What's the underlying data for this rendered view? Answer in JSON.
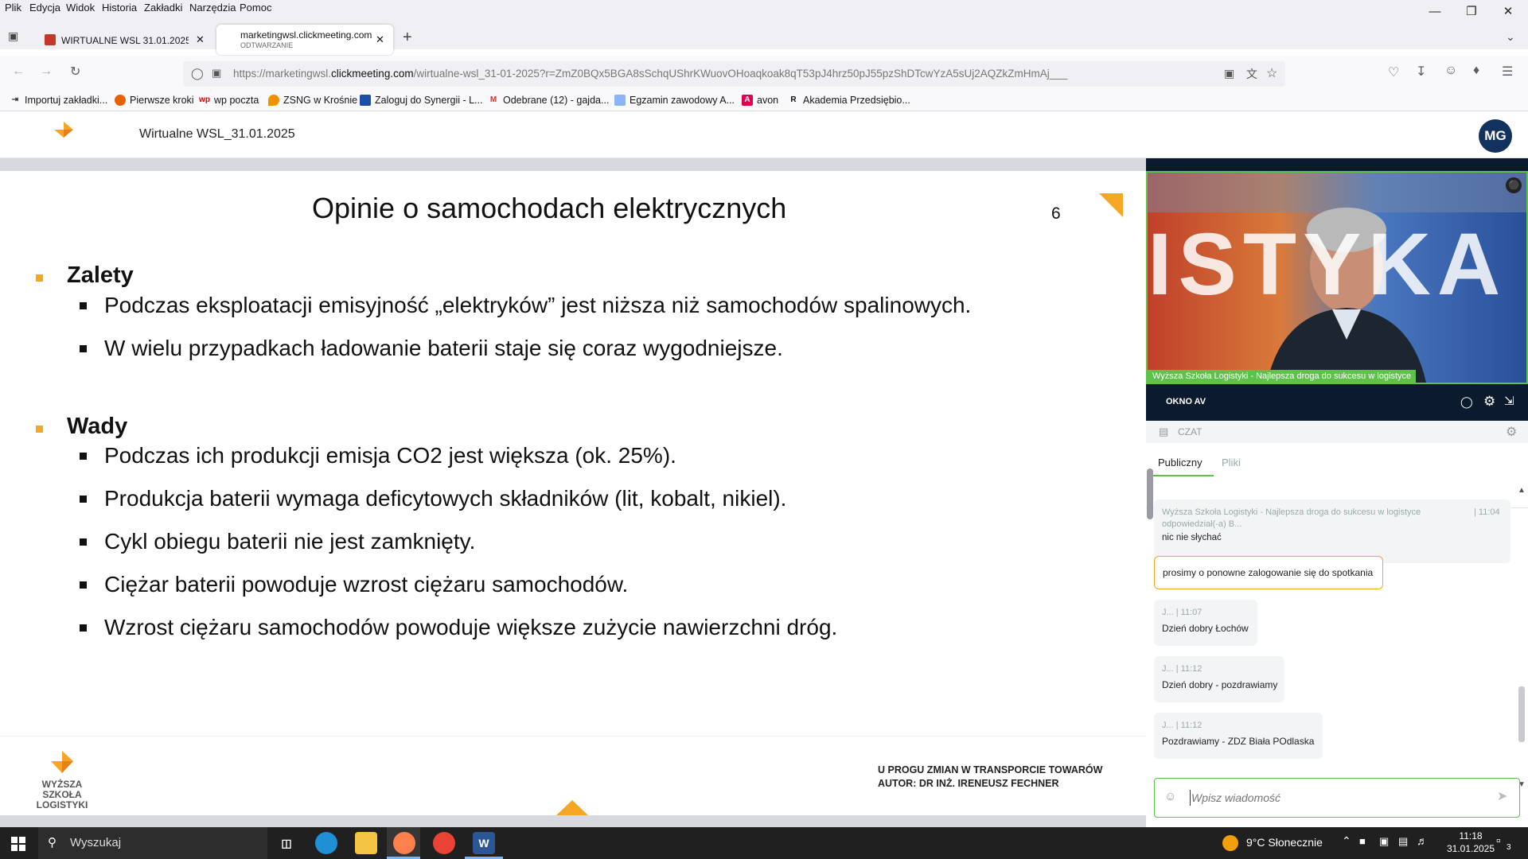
{
  "menubar": {
    "items": [
      "Plik",
      "Edycja",
      "Widok",
      "Historia",
      "Zakładki",
      "Narzędzia",
      "Pomoc"
    ]
  },
  "tabs": [
    {
      "title": "WIRTUALNE WSL 31.01.2025 - W",
      "subtitle": ""
    },
    {
      "title": "marketingwsl.clickmeeting.com",
      "subtitle": "ODTWARZANIE"
    }
  ],
  "urlbar": {
    "url_prefix": "https://marketingwsl.",
    "url_domain": "clickmeeting.com",
    "url_rest": "/wirtualne-wsl_31-01-2025?r=ZmZ0BQx5BGA8sSchqUShrKWuovOHoaqkoak8qT53pJ4hrz50pJ55pzShDTcwYzA5sUj2AQZkZmHmAj___"
  },
  "bookmarks": [
    {
      "label": "Importuj zakładki...",
      "icon": "import-icon"
    },
    {
      "label": "Pierwsze kroki",
      "icon": "firefox-icon"
    },
    {
      "label": "wp poczta",
      "icon": "wp-icon"
    },
    {
      "label": "ZSNG w Krośnie",
      "icon": "flame-icon"
    },
    {
      "label": "Zaloguj do Synergii - L...",
      "icon": "synergia-icon"
    },
    {
      "label": "Odebrane (12) - gajda...",
      "icon": "gmail-icon"
    },
    {
      "label": "Egzamin zawodowy A...",
      "icon": "doc-icon"
    },
    {
      "label": "avon",
      "icon": "avon-icon"
    },
    {
      "label": "Akademia Przedsiębio...",
      "icon": "r-icon"
    }
  ],
  "app": {
    "title": "Wirtualne WSL_31.01.2025",
    "avatar_initials": "MG",
    "logo_text": "WYŻSZA SZKOŁA LOGISTYKI"
  },
  "slide": {
    "title": "Opinie o samochodach elektrycznych",
    "page_number": "6",
    "sections": [
      {
        "heading": "Zalety",
        "items": [
          "Podczas eksploatacji emisyjność „elektryków” jest niższa niż samochodów spalinowych.",
          "W wielu przypadkach ładowanie baterii staje się coraz wygodniejsze."
        ]
      },
      {
        "heading": "Wady",
        "items": [
          "Podczas ich produkcji emisja CO2 jest większa (ok. 25%).",
          "Produkcja baterii wymaga deficytowych składników (lit, kobalt, nikiel).",
          "Cykl obiegu baterii nie jest zamknięty.",
          "Ciężar baterii powoduje wzrost ciężaru samochodów.",
          "Wzrost ciężaru samochodów powoduje większe zużycie nawierzchni dróg."
        ]
      }
    ],
    "footer_line1": "U PROGU ZMIAN W TRANSPORCIE TOWARÓW",
    "footer_line2": "AUTOR: DR INŻ. IRENEUSZ FECHNER",
    "footer_logo_line1": "WYŻSZA SZKOŁA",
    "footer_logo_line2": "LOGISTYKI"
  },
  "video": {
    "background_text": "ISTYKA",
    "caption": "Wyższa Szkoła Logistyki - Najlepsza droga do sukcesu w logistyce",
    "panel_label": "OKNO AV"
  },
  "chat": {
    "header": "CZAT",
    "tabs": [
      "Publiczny",
      "Pliki"
    ],
    "messages": [
      {
        "meta": "Wyższa Szkoła Logistyki - Najlepsza droga do sukcesu w logistyce",
        "meta2": "odpowiedział(-a) B...",
        "time": "| 11:04",
        "text": "nic nie słychać"
      },
      {
        "meta": "",
        "time": "",
        "text": "prosimy o ponowne zalogowanie się do spotkania"
      },
      {
        "meta": "J... | 11:07",
        "time": "",
        "text": "Dzień dobry Łochów"
      },
      {
        "meta": "J... | 11:12",
        "time": "",
        "text": "Dzień dobry - pozdrawiamy"
      },
      {
        "meta": "J... | 11:12",
        "time": "",
        "text": "Pozdrawiamy - ZDZ Biała POdlaska"
      }
    ],
    "input_placeholder": "Wpisz wiadomość"
  },
  "taskbar": {
    "search_placeholder": "Wyszukaj",
    "weather": "9°C  Słonecznie",
    "time": "11:18",
    "date": "31.01.2025",
    "notification_count": "3"
  },
  "colors": {
    "accent_orange": "#f5a623",
    "green": "#5dc14a",
    "navy": "#12315c"
  }
}
